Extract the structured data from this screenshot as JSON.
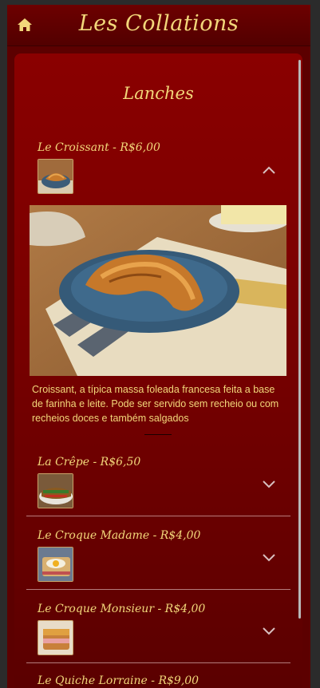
{
  "app": {
    "title": "Les Collations"
  },
  "section": {
    "title": "Lanches"
  },
  "items": [
    {
      "name": "Le Croissant - R$6,00",
      "expanded": true
    },
    {
      "name": "La Crêpe - R$6,50",
      "expanded": false
    },
    {
      "name": "Le Croque Madame - R$4,00",
      "expanded": false
    },
    {
      "name": "Le Croque Monsieur - R$4,00",
      "expanded": false
    },
    {
      "name": "Le Quiche Lorraine - R$9,00",
      "expanded": false
    }
  ],
  "detail": {
    "description": "Croissant, a típica massa foleada francesa feita a base de farinha e leite. Pode ser servido sem recheio ou com recheios doces e também salgados"
  },
  "colors": {
    "accent": "#f2d77a",
    "panel": "#7a0000",
    "header": "#5c0000"
  },
  "icons": [
    "home-icon",
    "chevron-up-icon",
    "chevron-down-icon"
  ]
}
